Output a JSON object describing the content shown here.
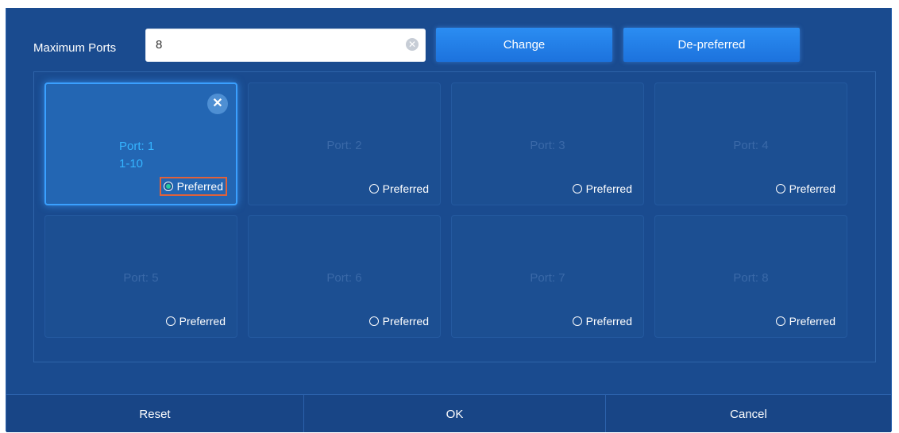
{
  "max_ports": {
    "label": "Maximum Ports",
    "value": "8",
    "clear_icon": "clear-circle-icon"
  },
  "buttons": {
    "change": "Change",
    "depreferred": "De-preferred"
  },
  "ports": [
    {
      "title": "Port: 1",
      "range": "1-10",
      "preferred_label": "Preferred",
      "preferred": true,
      "active": true,
      "remove_icon": "close-icon"
    },
    {
      "title": "Port: 2",
      "preferred_label": "Preferred",
      "preferred": false
    },
    {
      "title": "Port: 3",
      "preferred_label": "Preferred",
      "preferred": false
    },
    {
      "title": "Port: 4",
      "preferred_label": "Preferred",
      "preferred": false
    },
    {
      "title": "Port: 5",
      "preferred_label": "Preferred",
      "preferred": false
    },
    {
      "title": "Port: 6",
      "preferred_label": "Preferred",
      "preferred": false
    },
    {
      "title": "Port: 7",
      "preferred_label": "Preferred",
      "preferred": false
    },
    {
      "title": "Port: 8",
      "preferred_label": "Preferred",
      "preferred": false
    }
  ],
  "footer": {
    "reset": "Reset",
    "ok": "OK",
    "cancel": "Cancel"
  },
  "colors": {
    "background": "#1a4b8f",
    "accent": "#2b8df2",
    "active_text": "#35b4ff",
    "selected_radio": "#27c9a0",
    "highlight_box": "#e0613a"
  }
}
